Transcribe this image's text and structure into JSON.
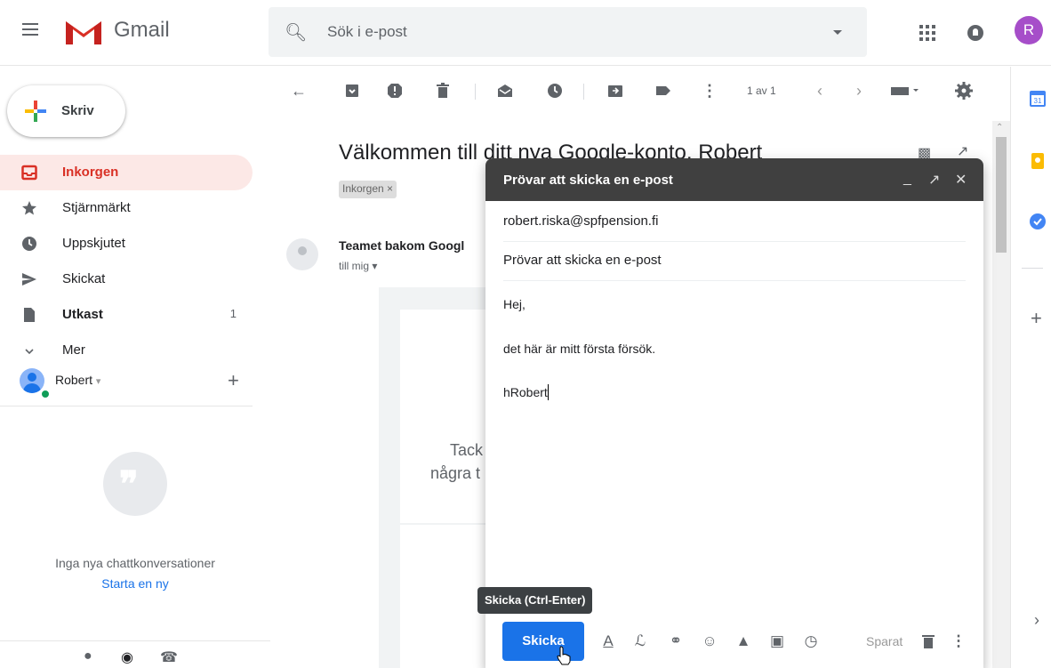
{
  "app": {
    "name": "Gmail",
    "avatar_letter": "R",
    "avatar_color": "#a64ec9"
  },
  "search": {
    "placeholder": "Sök i e-post"
  },
  "compose_button": {
    "label": "Skriv"
  },
  "nav": [
    {
      "label": "Inkorgen",
      "icon": "inbox-icon",
      "active": true
    },
    {
      "label": "Stjärnmärkt",
      "icon": "star-icon"
    },
    {
      "label": "Uppskjutet",
      "icon": "clock-icon"
    },
    {
      "label": "Skickat",
      "icon": "send-icon"
    },
    {
      "label": "Utkast",
      "icon": "draft-icon",
      "count": "1",
      "bold": true
    },
    {
      "label": "Mer",
      "icon": "chevron-down-icon"
    }
  ],
  "hangouts": {
    "user": "Robert",
    "empty_text": "Inga nya chattkonversationer",
    "start_link": "Starta en ny"
  },
  "toolbar": {
    "pagination": "1 av 1"
  },
  "email": {
    "subject": "Välkommen till ditt nya Google-konto, Robert",
    "label_chip": "Inkorgen ×",
    "sender": "Teamet bakom Googl",
    "to": "till mig ▾",
    "body_line1": "Tack f",
    "body_line2": "några t"
  },
  "compose": {
    "title": "Prövar att skicka en e-post",
    "to": "robert.riska@spfpension.fi",
    "subject": "Prövar att skicka en e-post",
    "body": [
      "Hej,",
      "det här är mitt första försök.",
      "hRobert"
    ],
    "send_label": "Skicka",
    "saved_label": "Sparat",
    "tooltip": "Skicka (Ctrl-Enter)"
  },
  "colors": {
    "accent": "#1a73e8",
    "inbox_active_bg": "#fce8e6",
    "inbox_active_text": "#d93025",
    "compose_header": "#404040"
  }
}
